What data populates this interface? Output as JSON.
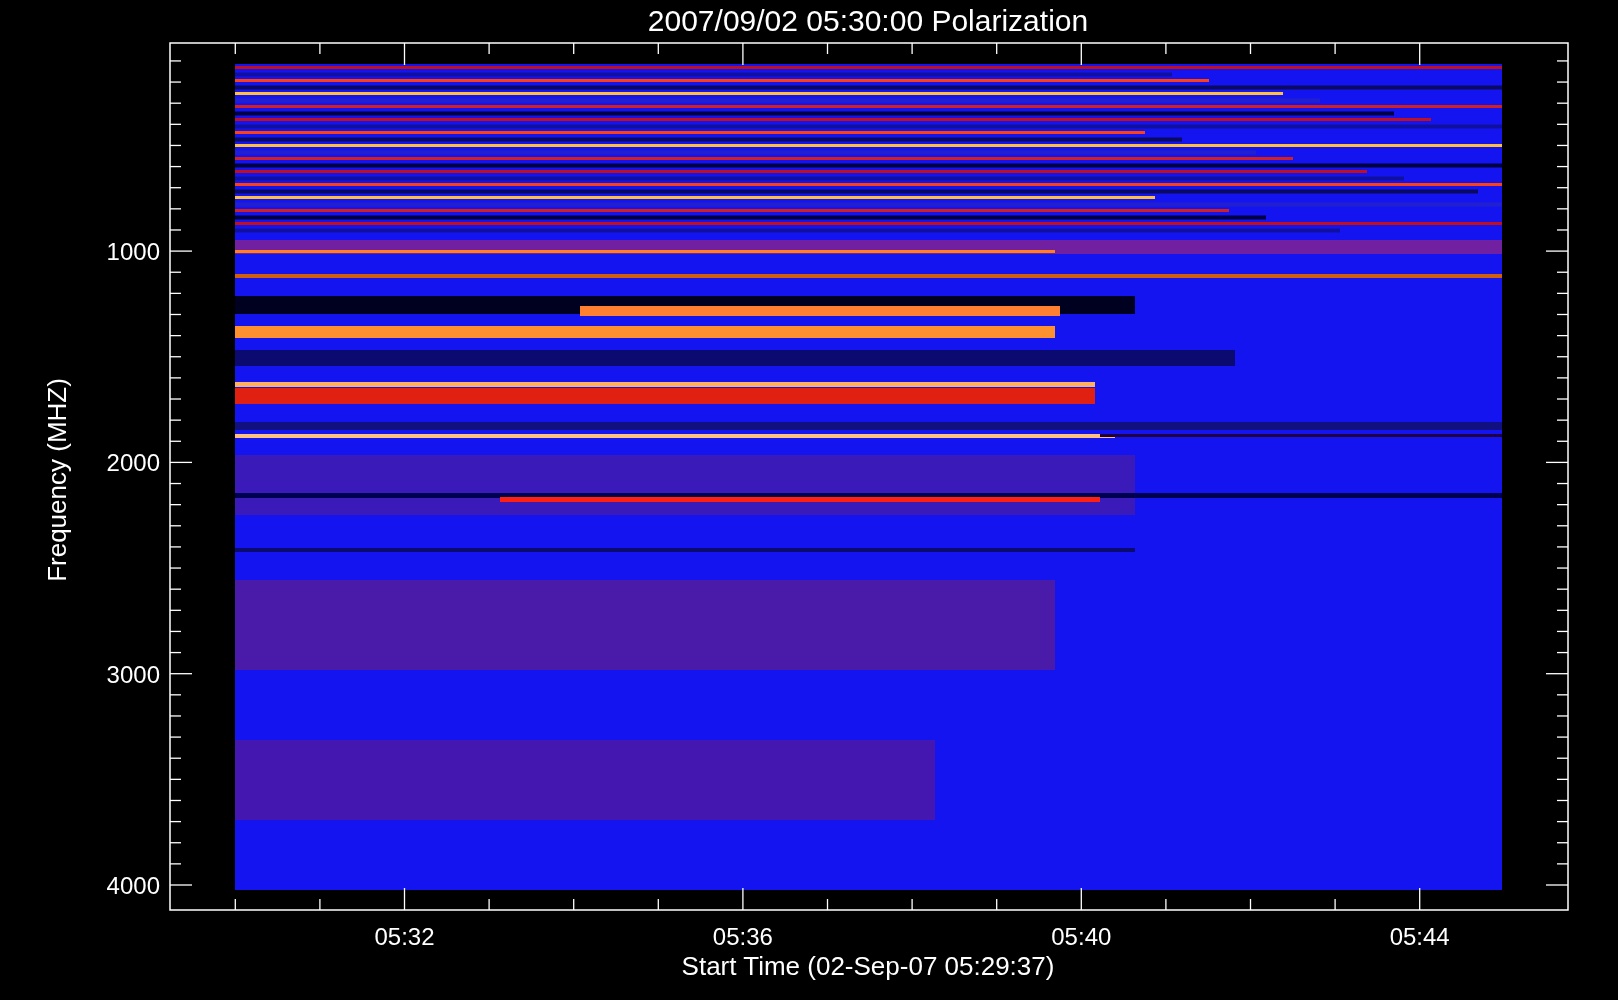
{
  "title": "2007/09/02 05:30:00 Polarization",
  "ylabel": "Frequency (MHZ)",
  "xlabel": "Start Time (02-Sep-07 05:29:37)",
  "yticks": [
    "1000",
    "2000",
    "3000",
    "4000"
  ],
  "xticks": [
    "05:32",
    "05:36",
    "05:40",
    "05:44"
  ]
}
